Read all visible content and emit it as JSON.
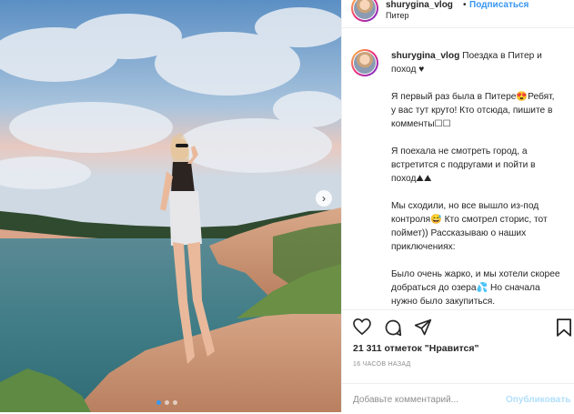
{
  "header": {
    "username": "shurygina_vlog",
    "separator": "•",
    "follow_label": "Подписаться",
    "location": "Питер"
  },
  "caption": {
    "username": "shurygina_vlog",
    "title": "Поездка в Питер и поход ♥",
    "paragraphs": [
      "Я первый раз была в Питере😍Ребят, у вас тут круто! Кто отсюда, пишите в комменты☐☐",
      "Я поехала не смотреть город, а встретится с подругами и пойти в поход⛰⛰",
      "Мы сходили, но все вышло из-под контроля😅 Кто смотрел сторис, тот поймет)) Рассказываю о наших приключениях:",
      "Было очень жарко, и мы хотели скорее добраться до озера💦 Но сначала нужно было закупиться."
    ]
  },
  "actions": {
    "like_icon": "heart-icon",
    "comment_icon": "speech-bubble-icon",
    "share_icon": "paper-plane-icon",
    "save_icon": "bookmark-icon"
  },
  "likes_text": "21 311 отметок \"Нравится\"",
  "time_ago": "16 ЧАСОВ НАЗАД",
  "comment_box": {
    "placeholder": "Добавьте комментарий...",
    "publish_label": "Опубликовать"
  },
  "carousel": {
    "current": 1,
    "total": 3
  },
  "colors": {
    "link_blue": "#3897f0",
    "publish_disabled": "#b2dffc",
    "muted": "#8e8e8e"
  }
}
